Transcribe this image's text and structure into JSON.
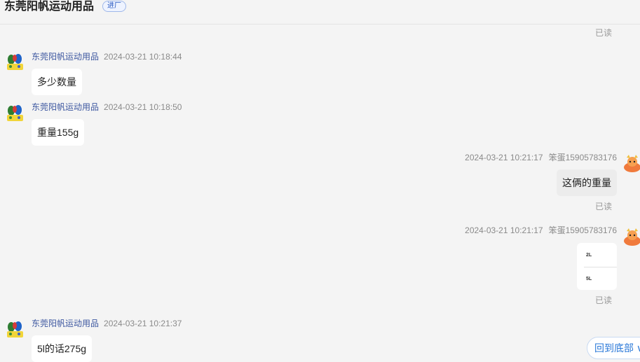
{
  "header": {
    "shop_name": "东莞阳帆运动用品",
    "badge": "进厂"
  },
  "read_label": "已读",
  "messages": [
    {
      "sender": "东莞阳帆运动用品",
      "time": "2024-03-21 10:18:44",
      "text": "多少数量"
    },
    {
      "sender": "东莞阳帆运动用品",
      "time": "2024-03-21 10:18:50",
      "text": "重量155g"
    },
    {
      "sender": "笨蛋15905783176",
      "time": "2024-03-21 10:21:17",
      "text": "这俩的重量"
    },
    {
      "sender": "笨蛋15905783176",
      "time": "2024-03-21 10:21:17",
      "image_labels": [
        "2L",
        "5L"
      ]
    },
    {
      "sender": "东莞阳帆运动用品",
      "time": "2024-03-21 10:21:37",
      "text": "5l的话275g"
    }
  ],
  "back_to_bottom": "回到底部 ∨",
  "icons": {
    "shop_avatar": "colorful-blobs-avatar-icon",
    "user_avatar": "orange-cartoon-avatar-icon"
  }
}
